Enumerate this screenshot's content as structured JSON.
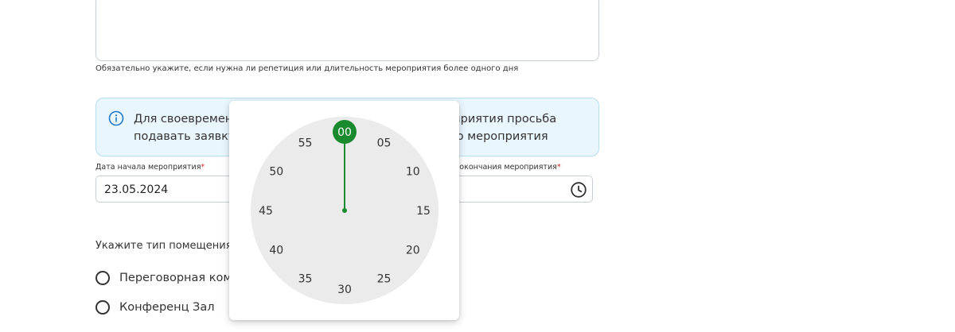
{
  "description_hint": "Обязательно укажите, если нужна ли репетиция или длительность мероприятия более одного дня",
  "info": {
    "text": "Для своевременной подготовки к проведению мероприятия просьба подавать заявку не позднее, чем за 3 рабочих дня до мероприятия"
  },
  "start_date": {
    "label": "Дата начала мероприятия",
    "required_mark": "*",
    "value": "23.05.2024"
  },
  "end_time": {
    "label": "Время окончания мероприятия",
    "required_mark": "*",
    "value": ""
  },
  "room_type": {
    "label": "Укажите тип помещения",
    "required_mark": "*",
    "options": [
      "Переговорная комната",
      "Конференц Зал"
    ]
  },
  "time_picker": {
    "mode": "minutes",
    "selected": "00",
    "minutes": [
      "00",
      "05",
      "10",
      "15",
      "20",
      "25",
      "30",
      "35",
      "40",
      "45",
      "50",
      "55"
    ],
    "colors": {
      "accent": "#1a8a2e",
      "face": "#ebebeb",
      "text": "#333333"
    }
  },
  "colors": {
    "required": "#d9261c",
    "info_bg": "#eaf6fd",
    "info_icon": "#1f78c8"
  },
  "icons": {
    "info": "info-circle-icon",
    "clock": "clock-icon"
  }
}
